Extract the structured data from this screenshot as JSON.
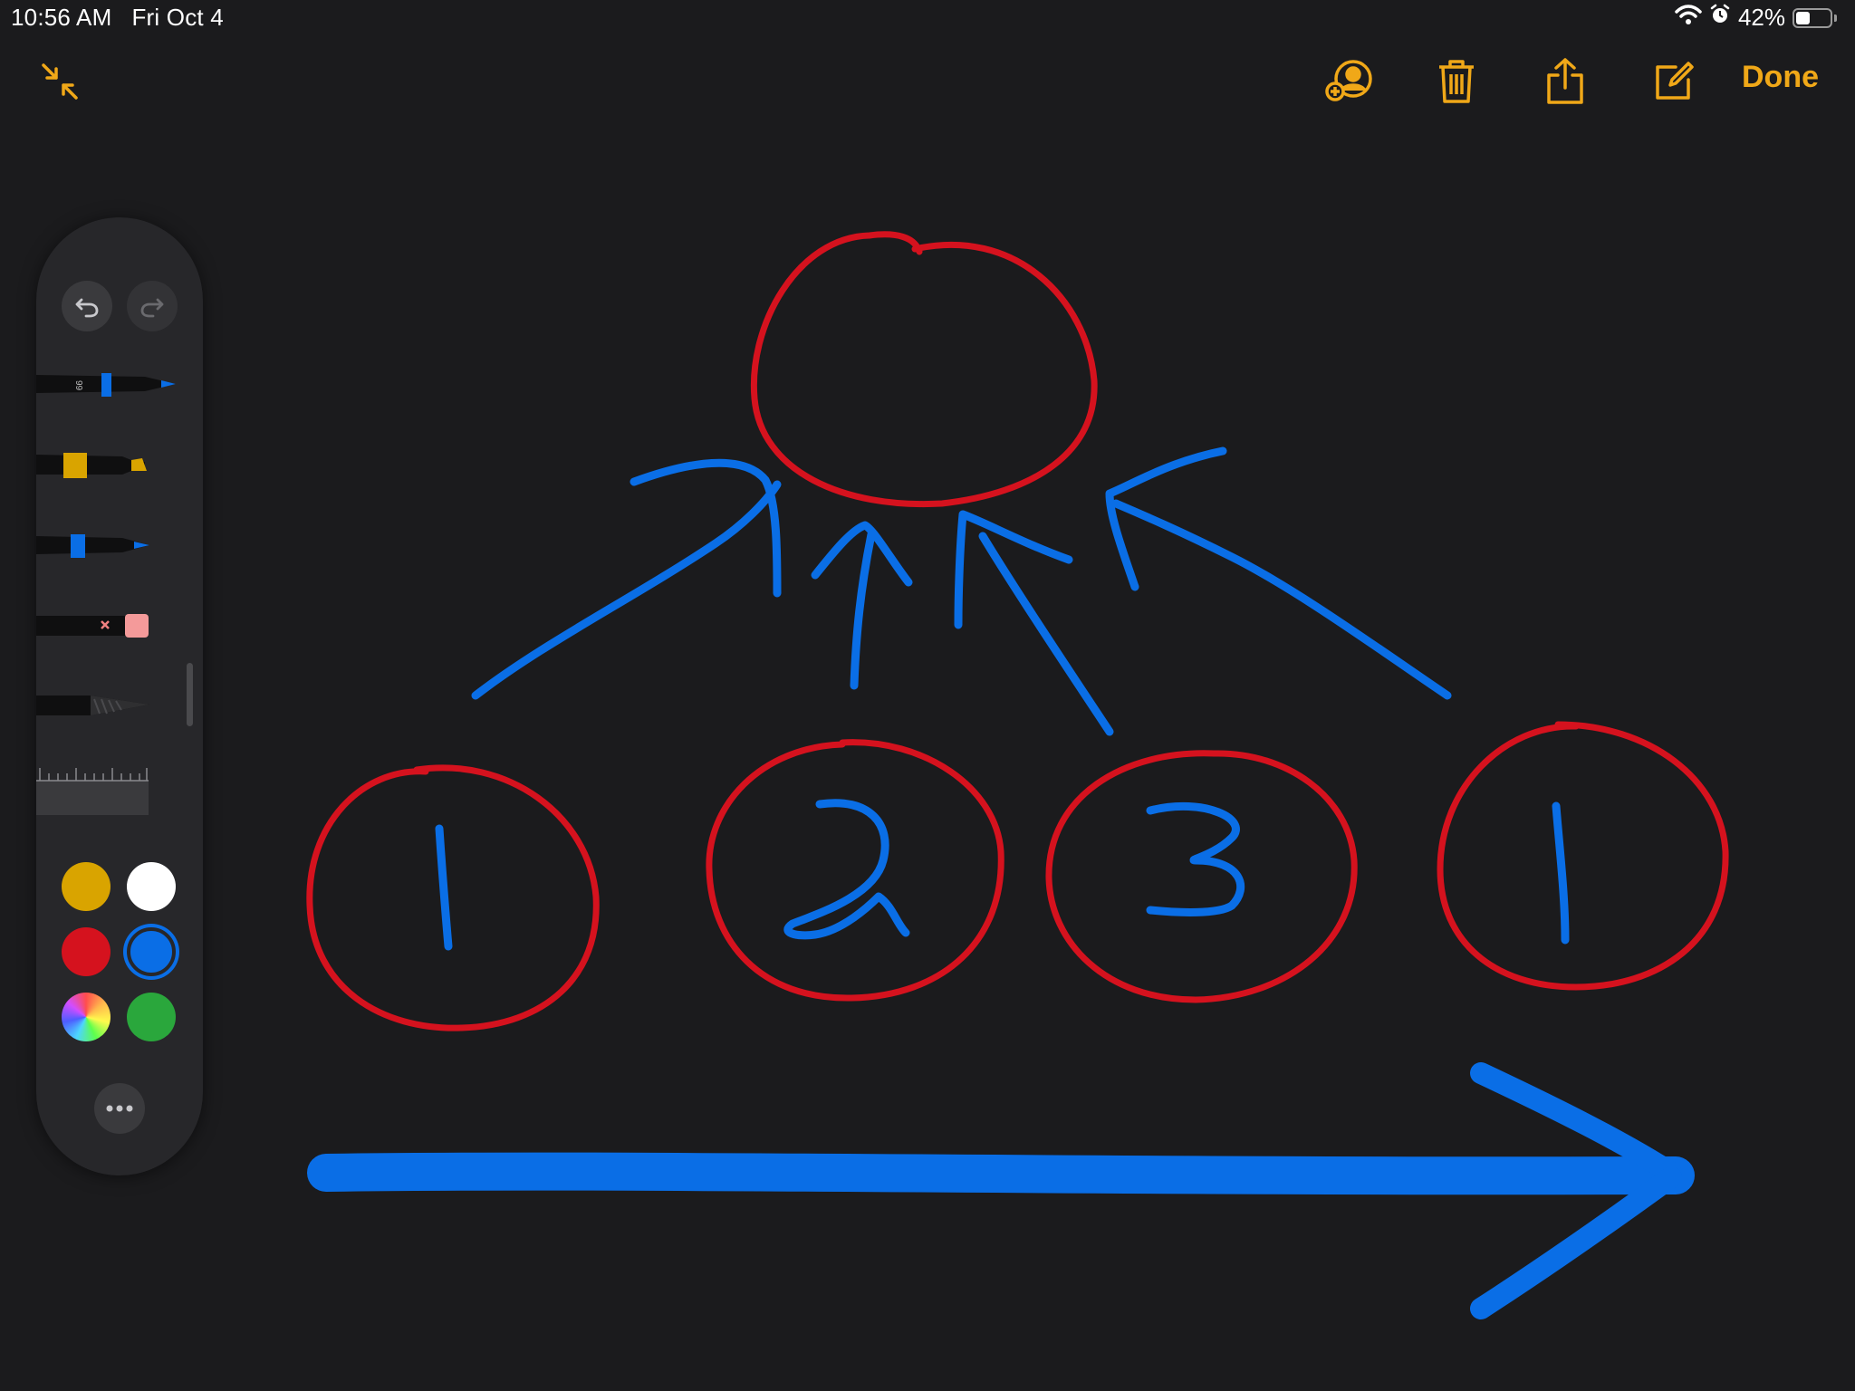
{
  "status_bar": {
    "time": "10:56 AM",
    "date": "Fri Oct 4",
    "battery_percent": "42%",
    "battery_level": 0.42
  },
  "toolbar": {
    "done_label": "Done",
    "accent_color": "#f0a818"
  },
  "palette": {
    "pen_label": "99",
    "colors": [
      "#d9a400",
      "#ffffff",
      "#d5121e",
      "#0a6ee6",
      "rainbow",
      "#2aa73c"
    ],
    "selected_color": "#0a6ee6"
  },
  "drawing": {
    "numbers": [
      "1",
      "2",
      "3",
      "1"
    ]
  }
}
